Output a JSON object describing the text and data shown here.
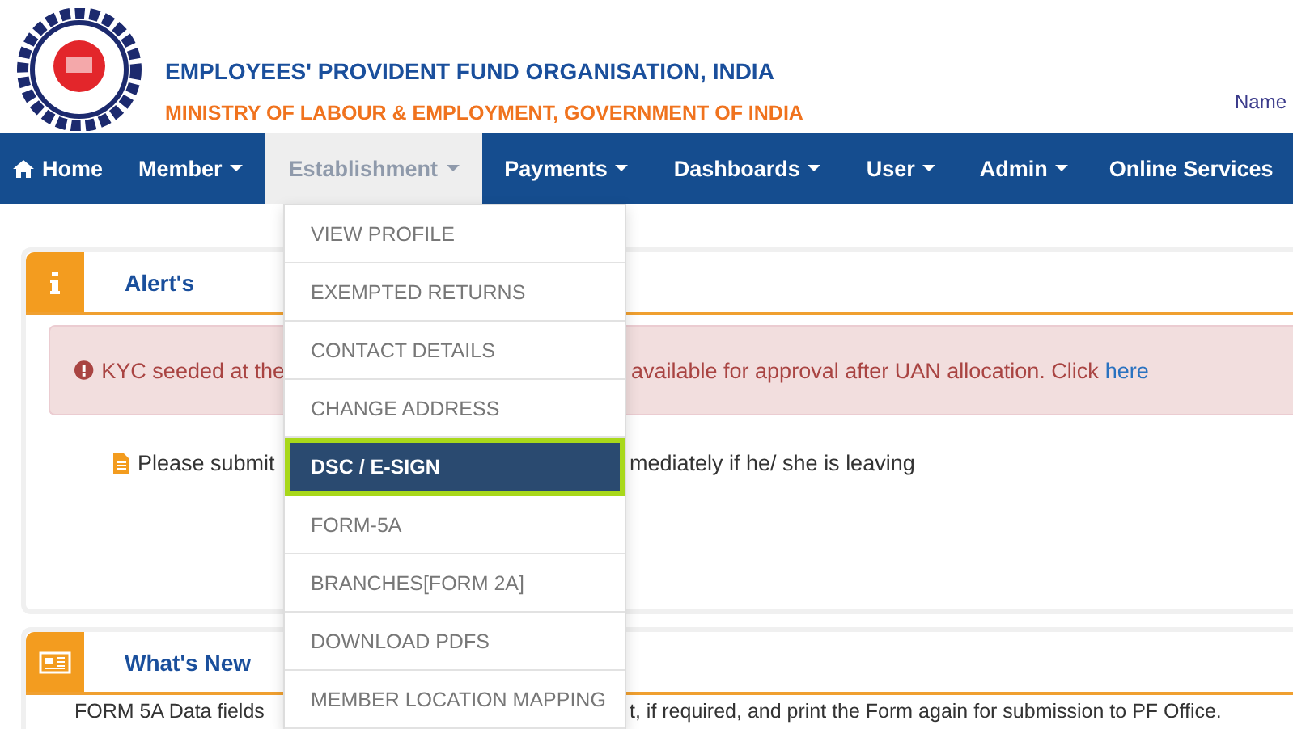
{
  "header": {
    "title": "EMPLOYEES' PROVIDENT FUND ORGANISATION, INDIA",
    "subtitle": "MINISTRY OF LABOUR & EMPLOYMENT, GOVERNMENT OF INDIA",
    "user_label": "Name"
  },
  "nav": [
    {
      "label": "Home",
      "kind": "home",
      "selected": false
    },
    {
      "label": "Member",
      "kind": "menu",
      "selected": false
    },
    {
      "label": "Establishment",
      "kind": "menu",
      "selected": true
    },
    {
      "label": "Payments",
      "kind": "menu",
      "selected": false
    },
    {
      "label": "Dashboards",
      "kind": "menu",
      "selected": false
    },
    {
      "label": "User",
      "kind": "menu",
      "selected": false
    },
    {
      "label": "Admin",
      "kind": "menu",
      "selected": false
    },
    {
      "label": "Online Services",
      "kind": "plain",
      "selected": false
    }
  ],
  "dropdown": [
    {
      "label": "VIEW PROFILE",
      "selected": false
    },
    {
      "label": "EXEMPTED RETURNS",
      "selected": false
    },
    {
      "label": "CONTACT DETAILS",
      "selected": false
    },
    {
      "label": "CHANGE ADDRESS",
      "selected": false
    },
    {
      "label": "DSC / E-SIGN",
      "selected": true
    },
    {
      "label": "FORM-5A",
      "selected": false
    },
    {
      "label": "BRANCHES[FORM 2A]",
      "selected": false
    },
    {
      "label": "DOWNLOAD PDFS",
      "selected": false
    },
    {
      "label": "MEMBER LOCATION MAPPING",
      "selected": false
    }
  ],
  "alerts_panel": {
    "title": "Alert's",
    "alert": {
      "text_left": "KYC seeded at the",
      "text_right": "available for approval after UAN allocation. Click",
      "link": "here"
    },
    "notice": {
      "text_left": "Please submit",
      "text_right": "mediately if he/ she is leaving"
    }
  },
  "news_panel": {
    "title": "What's New",
    "text_left": "FORM 5A Data fields",
    "text_right": "t, if required, and print the Form again for submission to PF Office."
  }
}
